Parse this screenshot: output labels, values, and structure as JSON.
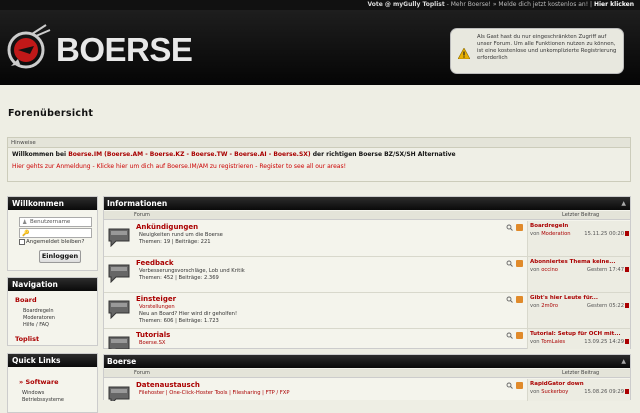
{
  "topbar": {
    "vote": "Vote @ myGully Toplist",
    "sep1": " - Mehr Boerse! » Melde dich jetzt kostenlos an! | ",
    "here": "Hier klicken"
  },
  "header": {
    "logo_text": "BOERSE",
    "guest_notice": "Als Gast hast du nur eingeschränkten Zugriff auf unser Forum. Um alle Funktionen nutzen zu können, ist eine kostenlose und unkomplizierte Registrierung erforderlich"
  },
  "page_title": "Forenübersicht",
  "notice": {
    "heading": "Hinweise",
    "welcome_prefix": "Willkommen bei ",
    "welcome_sites": "Boerse.IM (Boerse.AM - Boerse.KZ - Boerse.TW - Boerse.AI - Boerse.SX)",
    "welcome_suffix": " der richtigen Boerse BZ/SX/SH Alternative",
    "register_line": "Hier gehts zur Anmeldung - Klicke hier um dich auf Boerse.IM/AM zu registrieren - Register to see all our areas!"
  },
  "login": {
    "title": "Willkommen",
    "username_placeholder": "Benutzername",
    "password_placeholder": "",
    "remember_label": "Angemeldet bleiben?",
    "button": "Einloggen"
  },
  "navigation": {
    "title": "Navigation",
    "board": "Board",
    "items": [
      "Boardregeln",
      "Moderatoren",
      "Hilfe / FAQ"
    ],
    "toplist": "Toplist"
  },
  "quick_links": {
    "title": "Quick Links",
    "software": "Software",
    "items": [
      "Windows",
      "Betriebssysteme"
    ]
  },
  "columns": {
    "forum": "Forum",
    "last_post": "Letzter Beitrag"
  },
  "categories": [
    {
      "title": "Informationen",
      "forums": [
        {
          "title": "Ankündigungen",
          "desc": "Neuigkeiten rund um die Boerse",
          "stats": "Themen: 19 | Beiträge: 221",
          "last_title": "Boardregeln",
          "last_by": "Moderation",
          "last_date": "15.11.25 00:20"
        },
        {
          "title": "Feedback",
          "desc": "Verbesserungsvorschläge, Lob und Kritik",
          "stats": "Themen: 452 | Beiträge: 2.369",
          "last_title": "Abonniertes Thema keine...",
          "last_by": "occino",
          "last_date": "Gestern 17:47"
        },
        {
          "title": "Einsteiger",
          "desc": "Vorstellungen",
          "desc2": "Neu an Board? Hier wird dir geholfen!",
          "stats": "Themen: 606 | Beiträge: 1.723",
          "last_title": "Gibt's hier Leute für...",
          "last_by": "2m0ro",
          "last_date": "Gestern 05:22"
        },
        {
          "title": "Tutorials",
          "desc": "Boerse.SX",
          "desc2": "Hilfethemen und Anleitungen",
          "stats": "Themen: 118 | Beiträge: 396",
          "last_title": "Tutorial: Setup für OCH mit...",
          "last_by": "TomLaies",
          "last_date": "13.09.25 14:29"
        }
      ]
    },
    {
      "title": "Boerse",
      "forums": [
        {
          "title": "Datenaustausch",
          "desc": "Filehoster | One-Click-Hoster Tools | Filesharing | FTP / FXP",
          "last_title": "RapidGator down",
          "last_by": "Suckerboy",
          "last_date": "15.08.26 09:29"
        }
      ]
    }
  ],
  "by_prefix": "von ",
  "colors": {
    "accent": "#aa0000",
    "header_bg": "#0a0a0a",
    "page_bg": "#eeeee4"
  }
}
